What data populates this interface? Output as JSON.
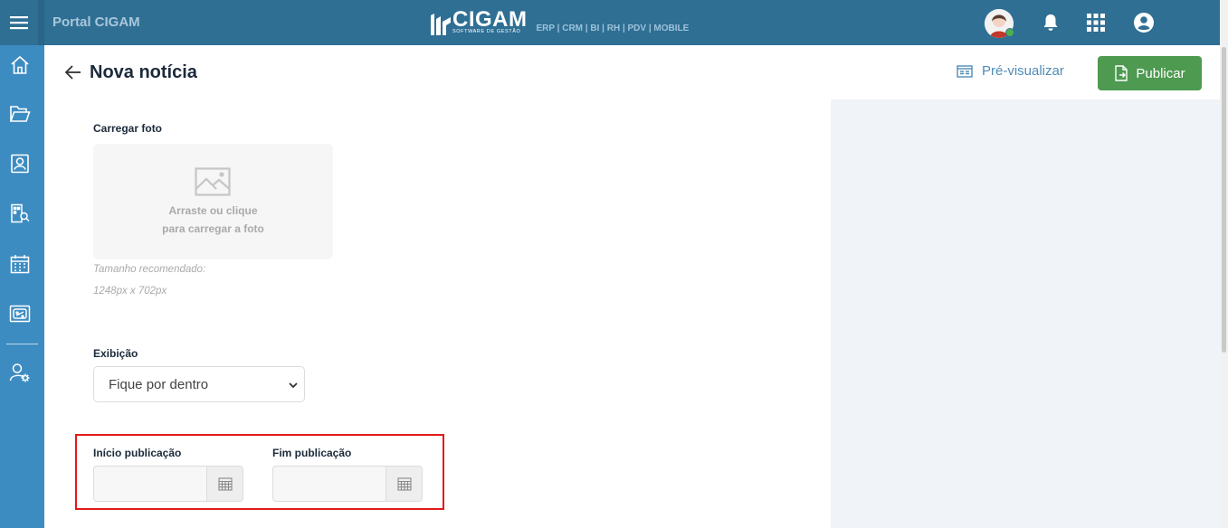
{
  "topbar": {
    "portal_title": "Portal CIGAM",
    "logo_name": "CIGAM",
    "logo_tagline": "SOFTWARE DE GESTÃO",
    "logo_modules": "ERP | CRM | BI | RH | PDV | MOBILE",
    "icons": [
      "menu-icon",
      "avatar",
      "bell-icon",
      "apps-grid-icon",
      "account-icon"
    ]
  },
  "sidebar": {
    "items": [
      "home-icon",
      "folder-icon",
      "contacts-icon",
      "org-search-icon",
      "calendar-icon",
      "tickets-icon",
      "user-settings-icon"
    ]
  },
  "page": {
    "title": "Nova notícia",
    "preview_label": "Pré-visualizar",
    "publish_label": "Publicar"
  },
  "form": {
    "photo_label": "Carregar foto",
    "dropzone_line1": "Arraste ou clique",
    "dropzone_line2": "para carregar a foto",
    "hint_line1": "Tamanho recomendado:",
    "hint_line2": "1248px x 702px",
    "display_label": "Exibição",
    "display_value": "Fique por dentro",
    "start_label": "Início publicação",
    "end_label": "Fim publicação",
    "start_value": "",
    "end_value": ""
  },
  "colors": {
    "topbar": "#2f6f94",
    "sidebar": "#3d8cc1",
    "publish": "#4d9a50",
    "highlight": "#e01a1a",
    "panel": "#f0f3f7"
  }
}
